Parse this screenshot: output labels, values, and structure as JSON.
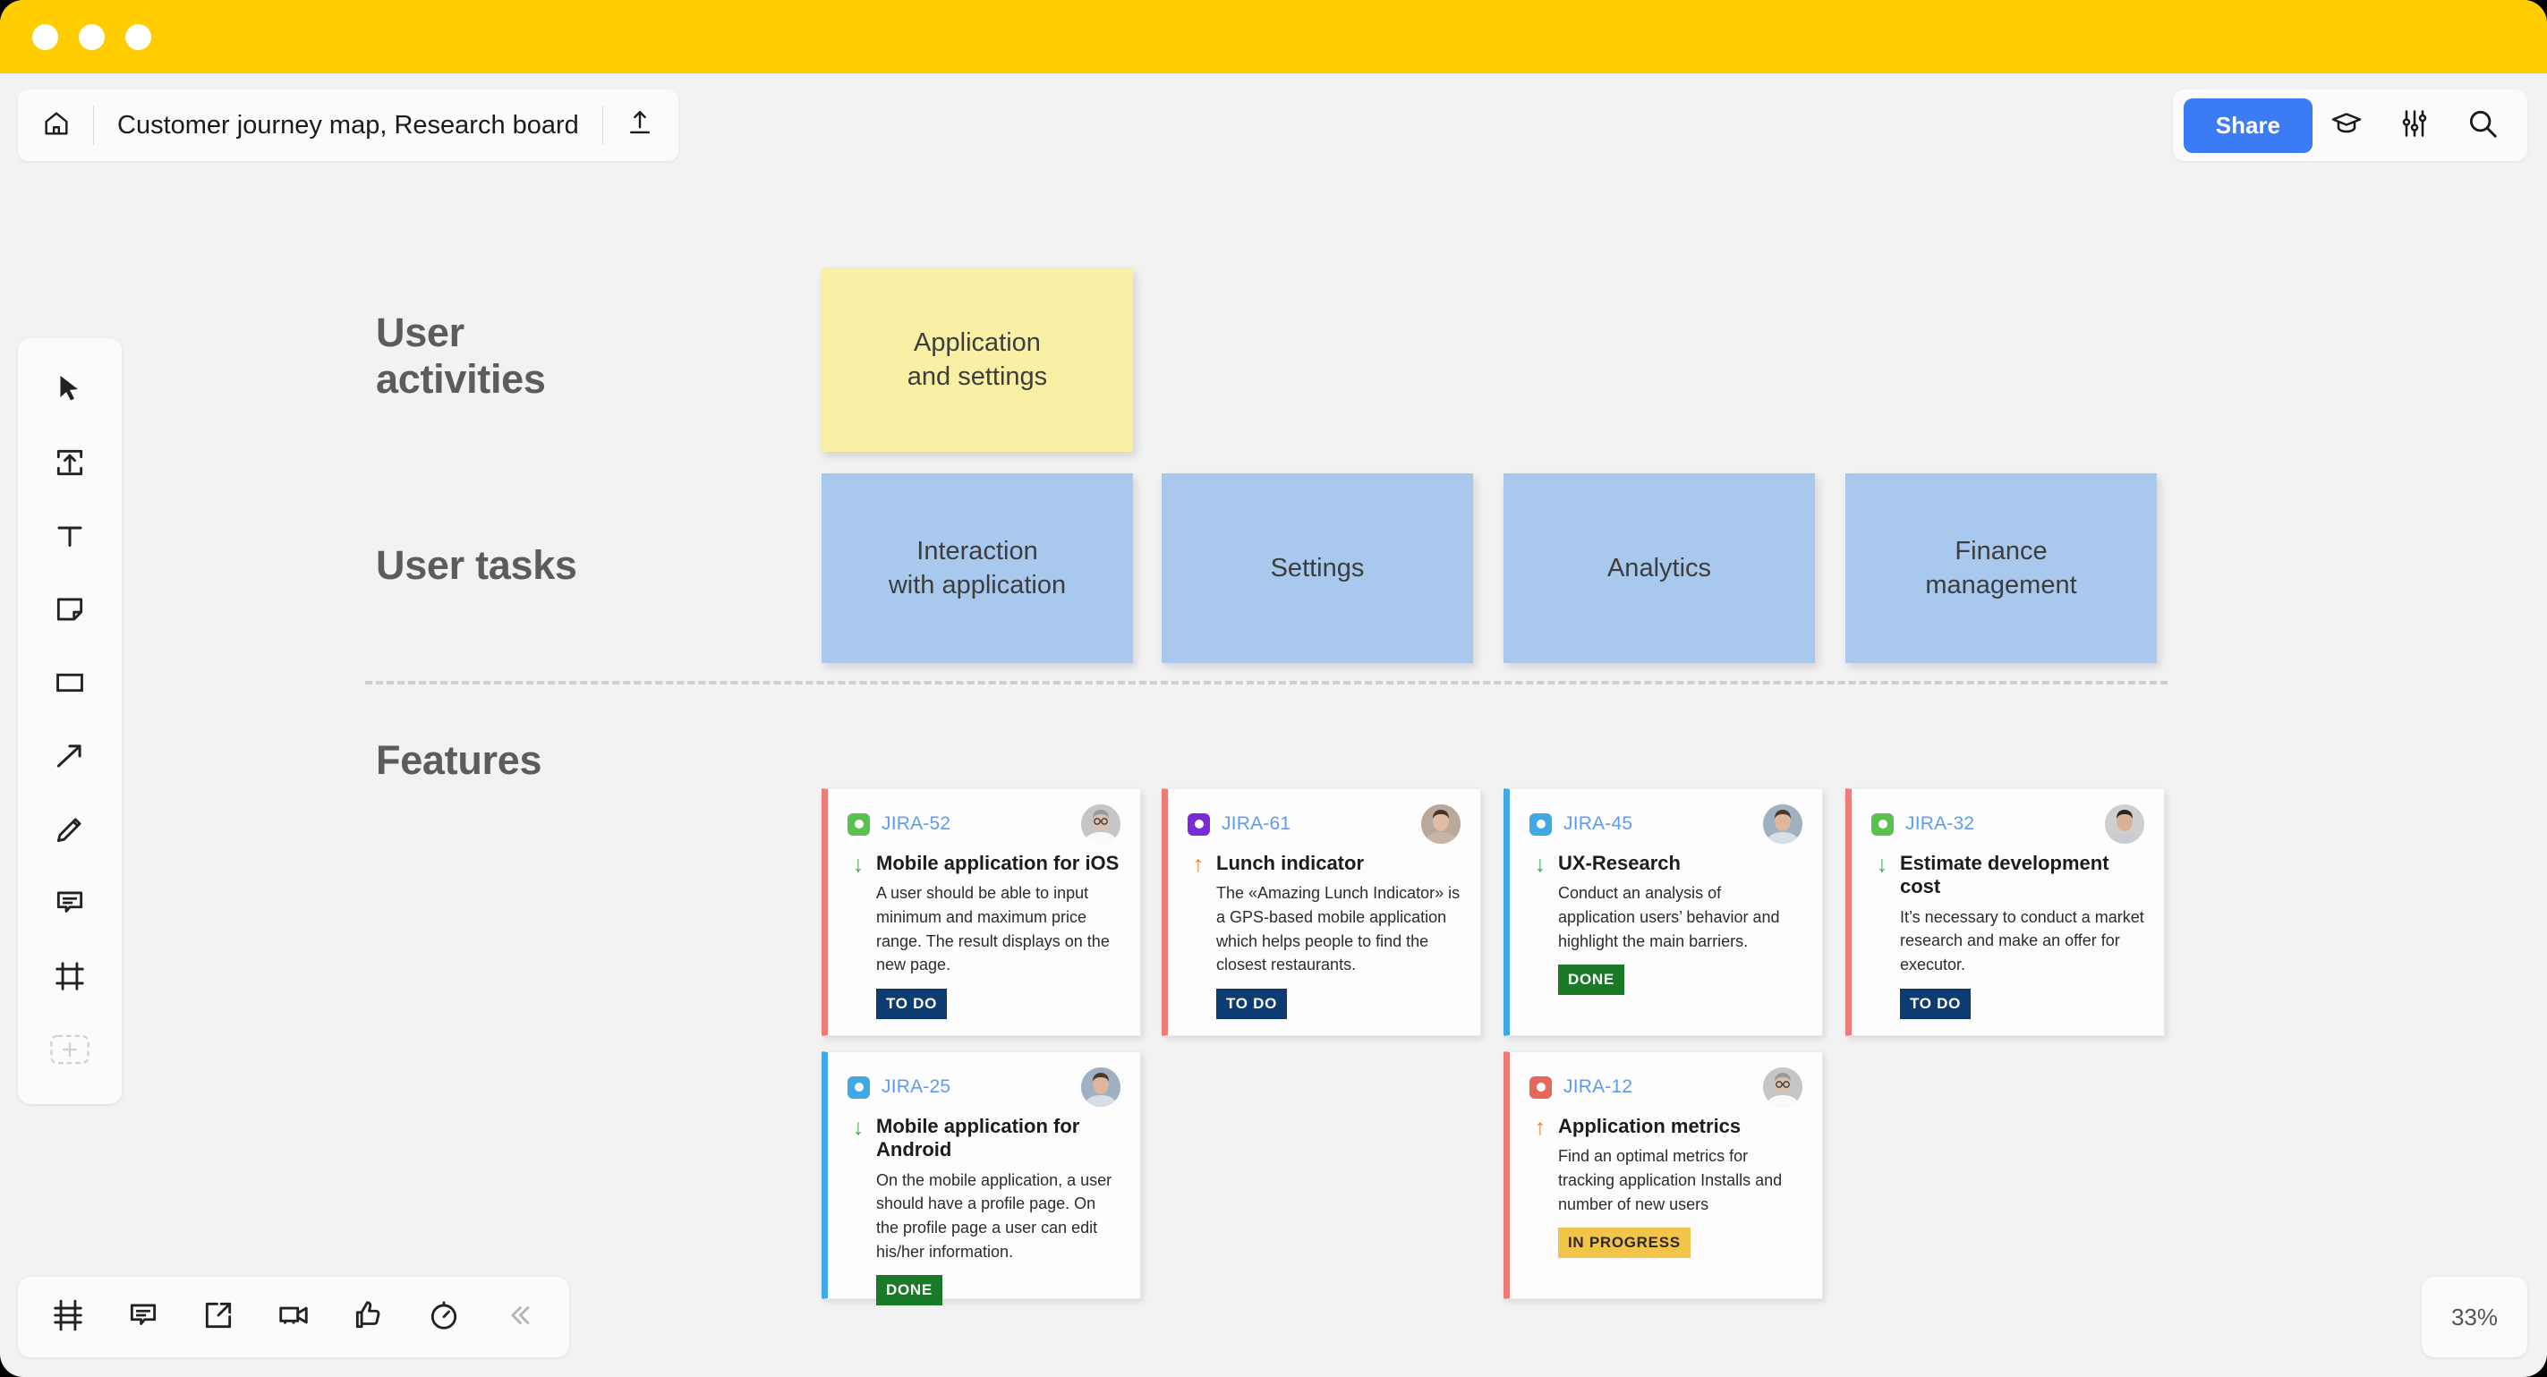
{
  "window": {
    "titlebar_color": "#FFCD00",
    "dots": [
      "window-dot-1",
      "window-dot-2",
      "window-dot-3"
    ]
  },
  "topbar": {
    "home_icon": "home-icon",
    "board_title": "Customer journey map, Research board",
    "export_icon": "export-upload-icon",
    "share_label": "Share",
    "share_color": "#3B7CF5",
    "tutorial_icon": "graduation-cap-icon",
    "settings_icon": "sliders-icon",
    "search_icon": "search-icon"
  },
  "left_toolbar": {
    "tools": [
      {
        "name": "cursor-select-tool",
        "icon": "cursor-arrow-icon"
      },
      {
        "name": "upload-image-tool",
        "icon": "upload-frame-icon"
      },
      {
        "name": "text-tool",
        "icon": "text-t-icon"
      },
      {
        "name": "sticky-note-tool",
        "icon": "sticky-note-icon"
      },
      {
        "name": "shape-tool",
        "icon": "rectangle-icon"
      },
      {
        "name": "arrow-tool",
        "icon": "arrow-diagonal-icon"
      },
      {
        "name": "pen-tool",
        "icon": "pencil-icon"
      },
      {
        "name": "comment-tool",
        "icon": "comment-bubble-icon"
      },
      {
        "name": "frame-tool",
        "icon": "frame-icon"
      },
      {
        "name": "add-more-tool",
        "icon": "plus-dashed-icon"
      }
    ]
  },
  "bottom_toolbar": {
    "tools": [
      {
        "name": "frames-panel-button",
        "icon": "frames-grid-icon"
      },
      {
        "name": "comments-button",
        "icon": "comment-lines-icon"
      },
      {
        "name": "present-button",
        "icon": "present-external-icon"
      },
      {
        "name": "video-chat-button",
        "icon": "video-camera-icon"
      },
      {
        "name": "reactions-button",
        "icon": "thumbs-up-icon"
      },
      {
        "name": "timer-button",
        "icon": "timer-clock-icon"
      },
      {
        "name": "collapse-button",
        "icon": "double-chevron-left-icon"
      }
    ]
  },
  "zoom": {
    "level": "33%"
  },
  "canvas": {
    "rows": [
      {
        "name": "user-activities",
        "label": "User\nactivities"
      },
      {
        "name": "user-tasks",
        "label": "User tasks"
      },
      {
        "name": "features",
        "label": "Features"
      }
    ],
    "activities": [
      {
        "name": "sticky-application-and-settings",
        "text": "Application\nand settings",
        "color": "#FAF0A5"
      }
    ],
    "tasks": [
      {
        "name": "sticky-interaction-with-application",
        "text": "Interaction\nwith application",
        "color": "#A8C8EE"
      },
      {
        "name": "sticky-settings",
        "text": "Settings",
        "color": "#A8C8EE"
      },
      {
        "name": "sticky-analytics",
        "text": "Analytics",
        "color": "#A8C8EE"
      },
      {
        "name": "sticky-finance-management",
        "text": "Finance\nmanagement",
        "color": "#A8C8EE"
      }
    ],
    "cards": [
      {
        "key": "JIRA-52",
        "type_color": "#5AC14E",
        "stripe_color": "#EF7B76",
        "priority": "down",
        "title": "Mobile application for iOS",
        "description": "A user should be able to input minimum and maximum price range. The result displays on the new page.",
        "status": "TO DO",
        "status_style": "st-todo",
        "avatar": "avatar-man-glasses"
      },
      {
        "key": "JIRA-61",
        "type_color": "#7A2BD6",
        "stripe_color": "#EF7B76",
        "priority": "up",
        "title": "Lunch indicator",
        "description": "The «Amazing Lunch Indicator» is a GPS-based mobile application which helps people to find the closest restaurants.",
        "status": "TO DO",
        "status_style": "st-todo",
        "avatar": "avatar-woman-brown-hair"
      },
      {
        "key": "JIRA-45",
        "type_color": "#3FA9E5",
        "stripe_color": "#3FA9E5",
        "priority": "down",
        "title": "UX-Research",
        "description": "Conduct an analysis of application users’ behavior and highlight the main barriers.",
        "status": "DONE",
        "status_style": "st-done",
        "avatar": "avatar-man-outdoors"
      },
      {
        "key": "JIRA-32",
        "type_color": "#5AC14E",
        "stripe_color": "#EF7B76",
        "priority": "down",
        "title": "Estimate development cost",
        "description": "It’s necessary to conduct a market research and make an offer for executor.",
        "status": "TO DO",
        "status_style": "st-todo",
        "avatar": "avatar-man-dark-hair"
      },
      {
        "key": "JIRA-25",
        "type_color": "#3FA9E5",
        "stripe_color": "#3FA9E5",
        "priority": "down",
        "title": "Mobile application for Android",
        "description": "On the mobile application, a user should have a profile page. On the profile page a user can edit his/her information.",
        "status": "DONE",
        "status_style": "st-done",
        "avatar": "avatar-man-outdoors"
      },
      {
        "key": "JIRA-12",
        "type_color": "#E8675B",
        "stripe_color": "#EF7B76",
        "priority": "up",
        "title": "Application metrics",
        "description": "Find an optimal metrics for tracking application Installs and number of new users",
        "status": "IN PROGRESS",
        "status_style": "st-prog",
        "avatar": "avatar-man-glasses"
      }
    ]
  }
}
